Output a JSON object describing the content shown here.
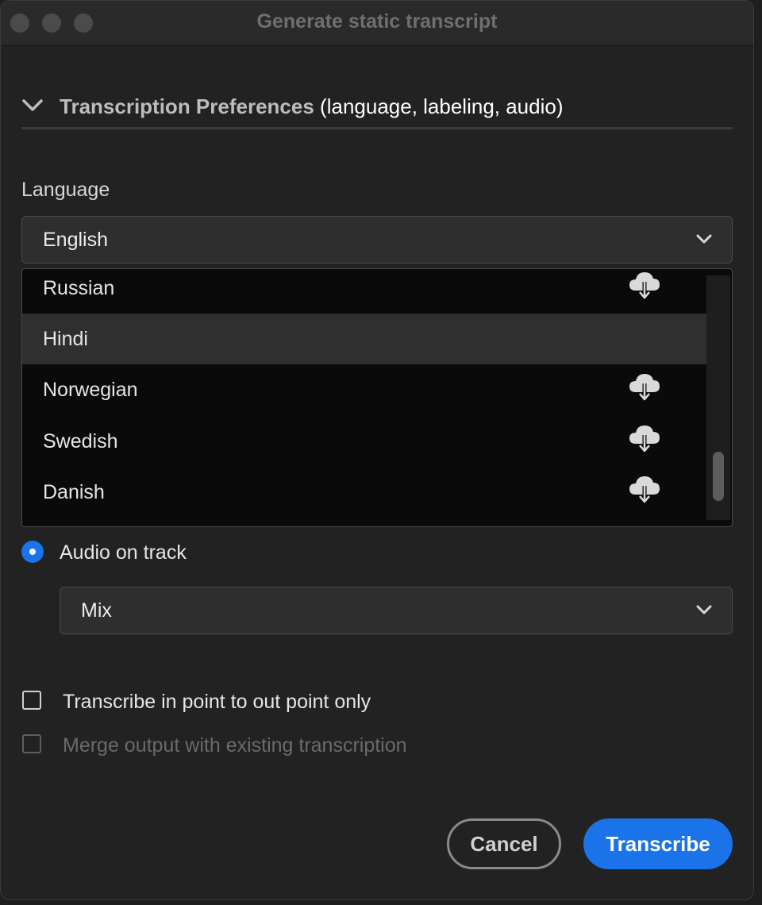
{
  "window": {
    "title": "Generate static transcript"
  },
  "section": {
    "title": "Transcription Preferences",
    "subtitle": "(language, labeling, audio)",
    "expanded": true
  },
  "language": {
    "label": "Language",
    "selected": "English",
    "options": [
      {
        "label": "Russian",
        "download_icon": true
      },
      {
        "label": "Hindi",
        "download_icon": false,
        "highlighted": true
      },
      {
        "label": "Norwegian",
        "download_icon": true
      },
      {
        "label": "Swedish",
        "download_icon": true
      },
      {
        "label": "Danish",
        "download_icon": true
      }
    ]
  },
  "audio": {
    "radio_label": "Audio on track",
    "selected": true,
    "track_value": "Mix"
  },
  "checkboxes": [
    {
      "label": "Transcribe in point to out point only",
      "checked": false,
      "disabled": false
    },
    {
      "label": "Merge output with existing transcription",
      "checked": false,
      "disabled": true
    }
  ],
  "buttons": {
    "cancel": "Cancel",
    "transcribe": "Transcribe"
  },
  "colors": {
    "accent": "#1a73e8",
    "window_bg": "#222222",
    "list_bg": "#0a0a0a",
    "highlight_row": "#2f2f2f"
  }
}
